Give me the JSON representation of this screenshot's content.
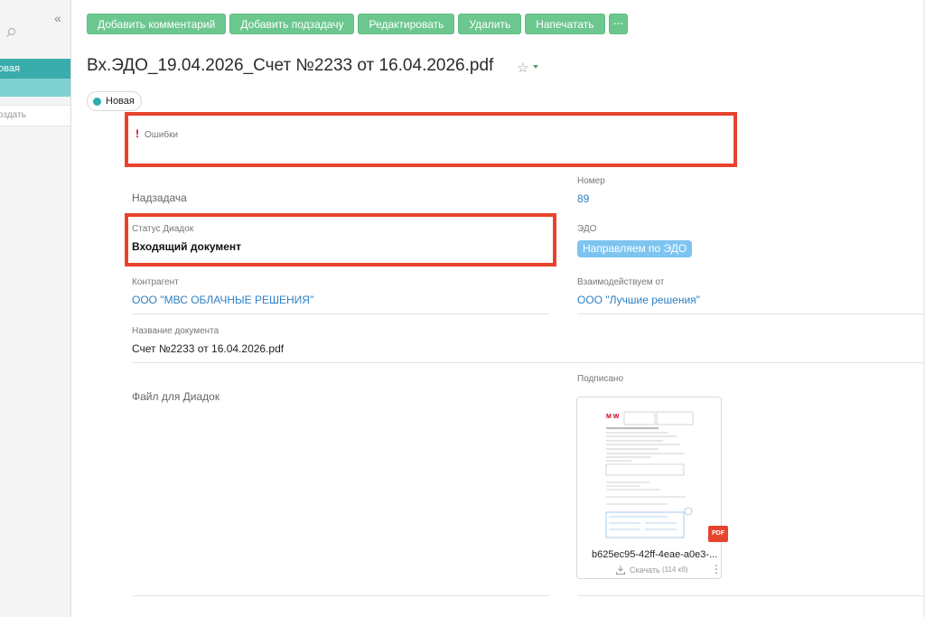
{
  "sidebar": {
    "collapse_icon": "«",
    "active_item": "овая",
    "create_item": "оздать"
  },
  "toolbar": {
    "buttons": [
      "Добавить комментарий",
      "Добавить подзадачу",
      "Редактировать",
      "Удалить",
      "Напечатать"
    ],
    "more_label": "···",
    "color": "#6cc78f"
  },
  "header": {
    "title": "Вх.ЭДО_19.04.2026_Счет №2233 от 16.04.2026.pdf",
    "star_icon": "☆"
  },
  "status": {
    "label": "Новая",
    "color": "#2aaeae"
  },
  "errors": {
    "icon": "!",
    "label": "Ошибки"
  },
  "fields": {
    "parent_task": {
      "label": "Надзадача"
    },
    "number": {
      "label": "Номер",
      "value": "89"
    },
    "diadok_status": {
      "label": "Статус Диадок",
      "value": "Входящий документ"
    },
    "edo": {
      "label": "ЭДО",
      "value": "Направляем по ЭДО"
    },
    "counterparty": {
      "label": "Контрагент",
      "value": "ООО \"МВС ОБЛАЧНЫЕ РЕШЕНИЯ\""
    },
    "interacting_from": {
      "label": "Взаимодействуем от",
      "value": "ООО \"Лучшие решения\""
    },
    "doc_name": {
      "label": "Название документа",
      "value": "Счет №2233 от 16.04.2026.pdf"
    },
    "diadok_file": {
      "label": "Файл для Диадок"
    },
    "signed": {
      "label": "Подписано"
    }
  },
  "file": {
    "name": "b625ec95-42ff-4eae-a0e3-...",
    "download_label": "Скачать",
    "size": "(114 кб)",
    "type_badge": "PDF",
    "logo_text": "M W"
  },
  "colors": {
    "accent": "#3aacac",
    "highlight_border": "#e8432c",
    "link": "#2e7fc2"
  }
}
